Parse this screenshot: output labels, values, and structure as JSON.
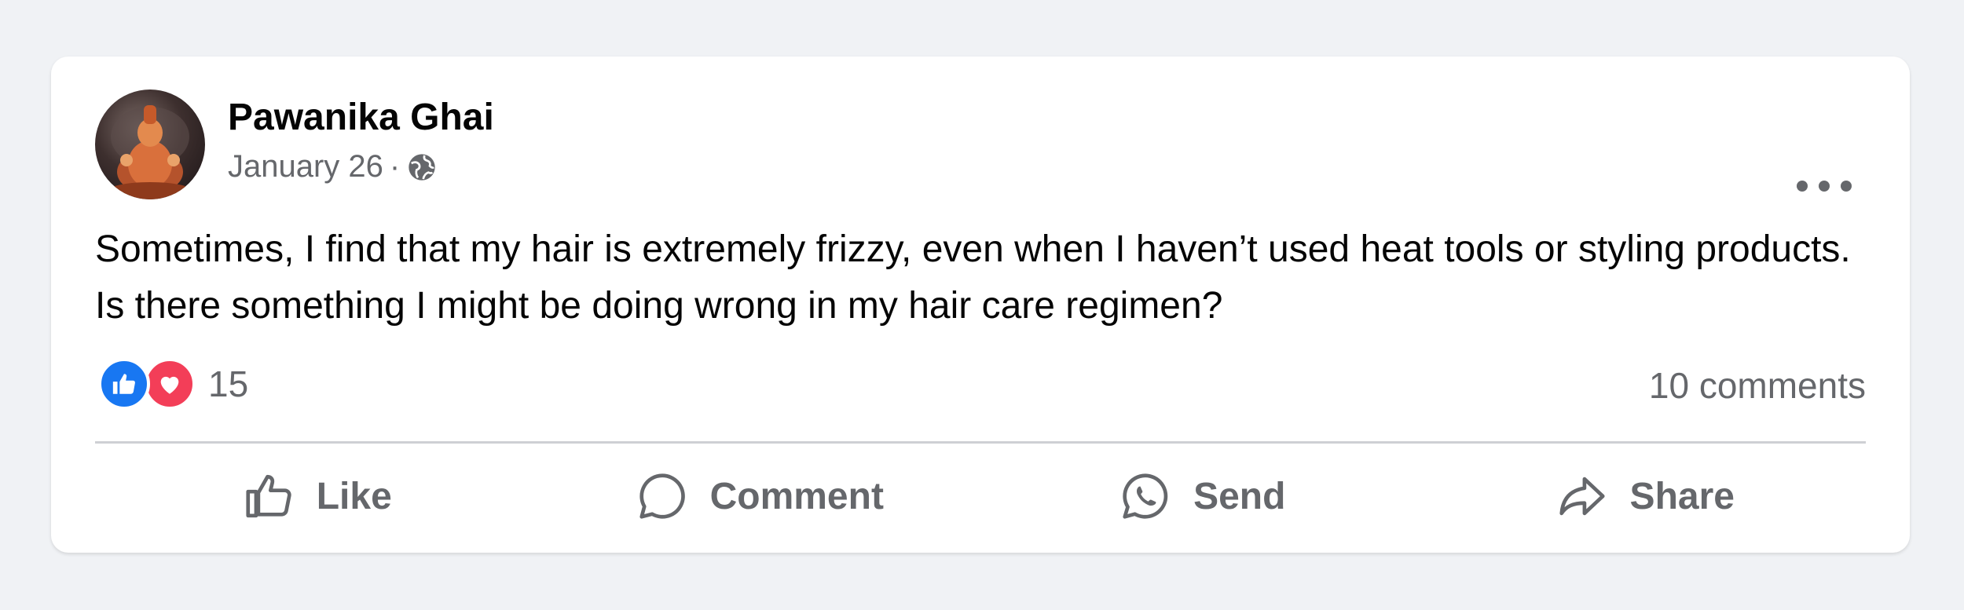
{
  "post": {
    "author": "Pawanika Ghai",
    "date": "January 26",
    "separator": "·",
    "privacy_icon": "globe-icon",
    "text": "Sometimes, I find that my hair is extremely frizzy, even when I haven’t used heat tools or styling products. Is there something I might be doing wrong in my hair care regimen?",
    "reactions": {
      "icons": [
        "like-reaction-icon",
        "love-reaction-icon"
      ],
      "count": "15"
    },
    "comments_label": "10 comments",
    "actions": {
      "like": "Like",
      "comment": "Comment",
      "send": "Send",
      "share": "Share"
    }
  },
  "colors": {
    "background": "#f0f2f5",
    "card": "#ffffff",
    "text_primary": "#050505",
    "text_secondary": "#65676b",
    "like_blue": "#1877f2",
    "love_red": "#f33e58",
    "divider": "#ced0d4"
  }
}
